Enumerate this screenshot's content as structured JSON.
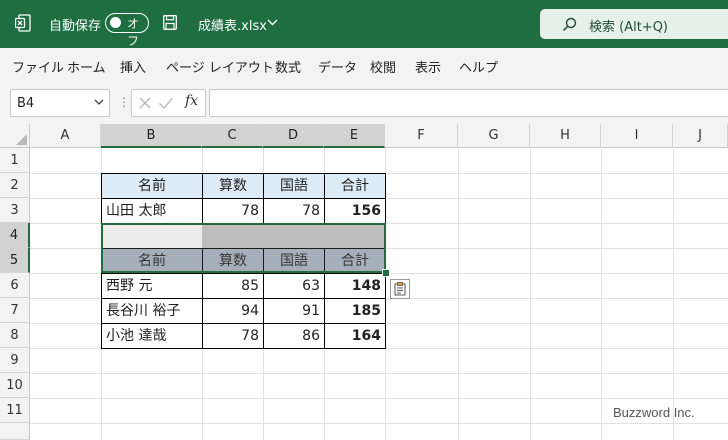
{
  "titlebar": {
    "autosave_label": "自動保存",
    "autosave_state": "オフ",
    "file_name": "成績表.xlsx",
    "search_label": "検索 (Alt+Q)",
    "accent_color": "#1e6e42"
  },
  "menu": [
    "ファイル",
    "ホーム",
    "挿入",
    "ページ レイアウト",
    "数式",
    "データ",
    "校閲",
    "表示",
    "ヘルプ"
  ],
  "formula_bar": {
    "name_box": "B4",
    "fx_label": "fx",
    "formula": ""
  },
  "columns": [
    "A",
    "B",
    "C",
    "D",
    "E",
    "F",
    "G",
    "H",
    "I",
    "J"
  ],
  "rows": [
    "1",
    "2",
    "3",
    "4",
    "5",
    "6",
    "7",
    "8",
    "9",
    "10",
    "11"
  ],
  "cells": {
    "B2": "名前",
    "C2": "算数",
    "D2": "国語",
    "E2": "合計",
    "B3": "山田 太郎",
    "C3": "78",
    "D3": "78",
    "E3": "156",
    "B5": "名前",
    "C5": "算数",
    "D5": "国語",
    "E5": "合計",
    "B6": "西野 元",
    "C6": "85",
    "D6": "63",
    "E6": "148",
    "B7": "長谷川 裕子",
    "C7": "94",
    "D7": "91",
    "E7": "185",
    "B8": "小池 達哉",
    "C8": "78",
    "D8": "86",
    "E8": "164"
  },
  "selection": "B4:E5",
  "watermark": "Buzzword Inc."
}
